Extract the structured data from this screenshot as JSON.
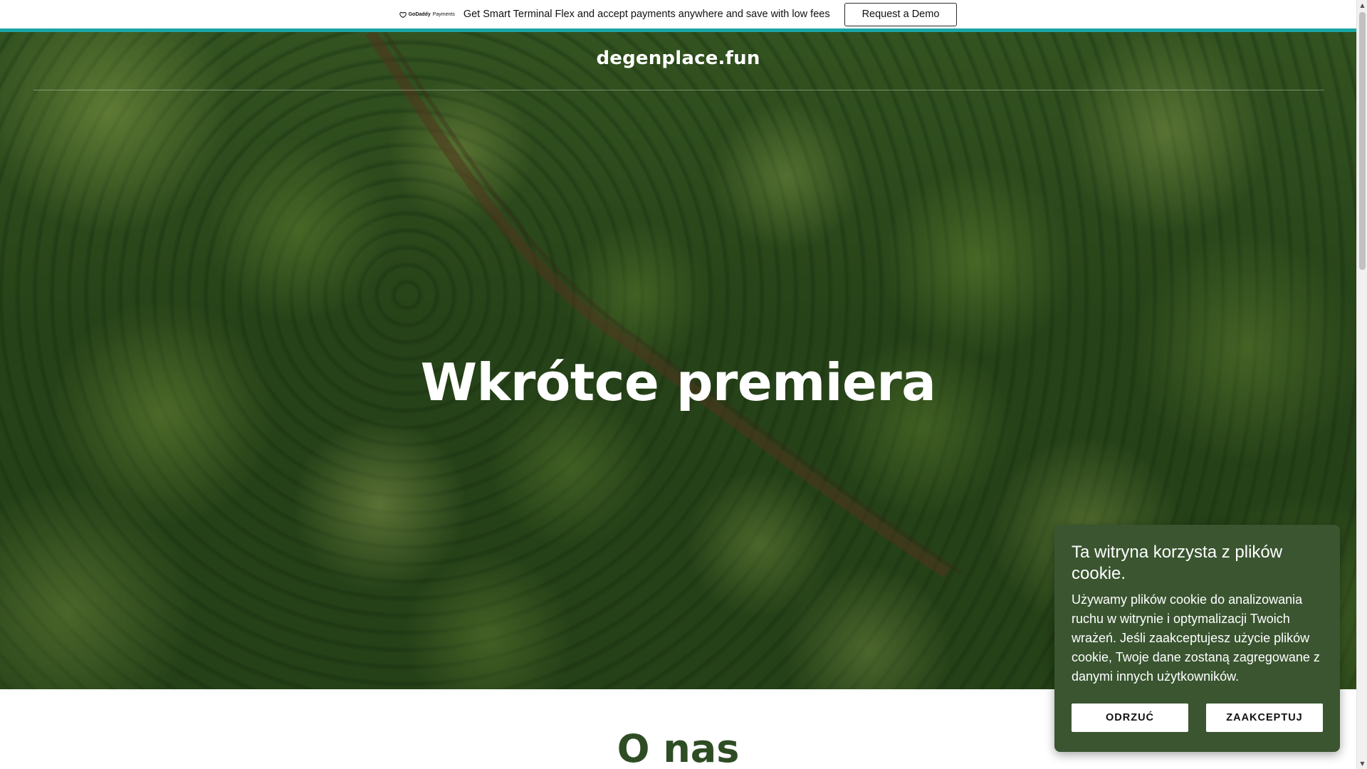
{
  "promo": {
    "logo_brand": "GoDaddy",
    "logo_suffix": "Payments",
    "text": "Get Smart Terminal Flex and accept payments anywhere and save with low fees",
    "button_label": "Request a Demo"
  },
  "header": {
    "site_title": "degenplace.fun"
  },
  "hero": {
    "heading": "Wkrótce premiera"
  },
  "about": {
    "title": "O nas"
  },
  "cookie_banner": {
    "title": "Ta witryna korzysta z plików cookie.",
    "body": "Używamy plików cookie do analizowania ruchu w witrynie i optymalizacji Twoich wrażeń. Jeśli zaakceptujesz użycie plików cookie, Twoje dane zostaną zagregowane z danymi innych użytkowników.",
    "decline_label": "ODRZUĆ",
    "accept_label": "ZAAKCEPTUJ"
  },
  "colors": {
    "promo_accent": "#1aa6a6",
    "cookie_background": "#3a5530",
    "section_title": "#2f4d24"
  },
  "icons": {
    "promo_logo": "godaddy-logo-icon",
    "scroll_up": "scroll-up-arrow-icon",
    "scroll_down": "scroll-down-arrow-icon"
  }
}
